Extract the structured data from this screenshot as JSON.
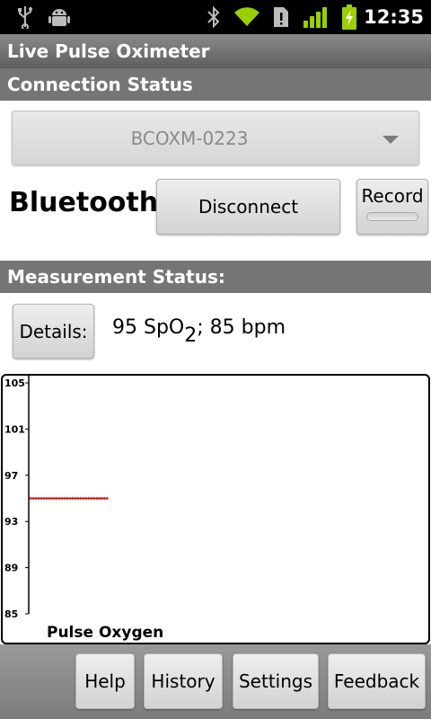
{
  "status_bar": {
    "time": "12:35",
    "icons": [
      "usb-icon",
      "android-debug-icon",
      "bluetooth-icon",
      "wifi-icon",
      "sim-icon",
      "signal-icon",
      "battery-charging-icon"
    ]
  },
  "app": {
    "title": "Live Pulse Oximeter"
  },
  "connection": {
    "header": "Connection Status",
    "device": "BCOXM-0223",
    "bluetooth_label": "Bluetooth:",
    "disconnect_label": "Disconnect",
    "record_label": "Record"
  },
  "measurement": {
    "header": "Measurement Status:",
    "details_label": "Details:",
    "spo2": "95",
    "spo_label": "SpO",
    "spo_sub": "2",
    "bpm_text": "; 85 bpm"
  },
  "chart_data": {
    "type": "line",
    "title": "",
    "xlabel": "Pulse Oxygen",
    "ylabel": "",
    "ylim": [
      85,
      105
    ],
    "yticks": [
      85,
      89,
      93,
      97,
      101,
      105
    ],
    "grid": false,
    "series": [
      {
        "color": "#e00000",
        "x": [
          0,
          1,
          2,
          3,
          4,
          5,
          6,
          7,
          8,
          9,
          10,
          11,
          12,
          13,
          14,
          15,
          16,
          17,
          18,
          19,
          20,
          21,
          22,
          23,
          24,
          25,
          26,
          27,
          28,
          29
        ],
        "values": [
          95,
          95,
          95,
          95,
          95,
          95,
          95,
          95,
          95,
          95,
          95,
          95,
          95,
          95,
          95,
          95,
          95,
          95,
          95,
          95,
          95,
          95,
          95,
          95,
          95,
          95,
          95,
          95,
          95,
          95
        ]
      }
    ],
    "xlim": [
      0,
      150
    ]
  },
  "nav": {
    "help": "Help",
    "history": "History",
    "settings": "Settings",
    "feedback": "Feedback"
  },
  "colors": {
    "header_bg": "#757575",
    "trace": "#e00000"
  }
}
